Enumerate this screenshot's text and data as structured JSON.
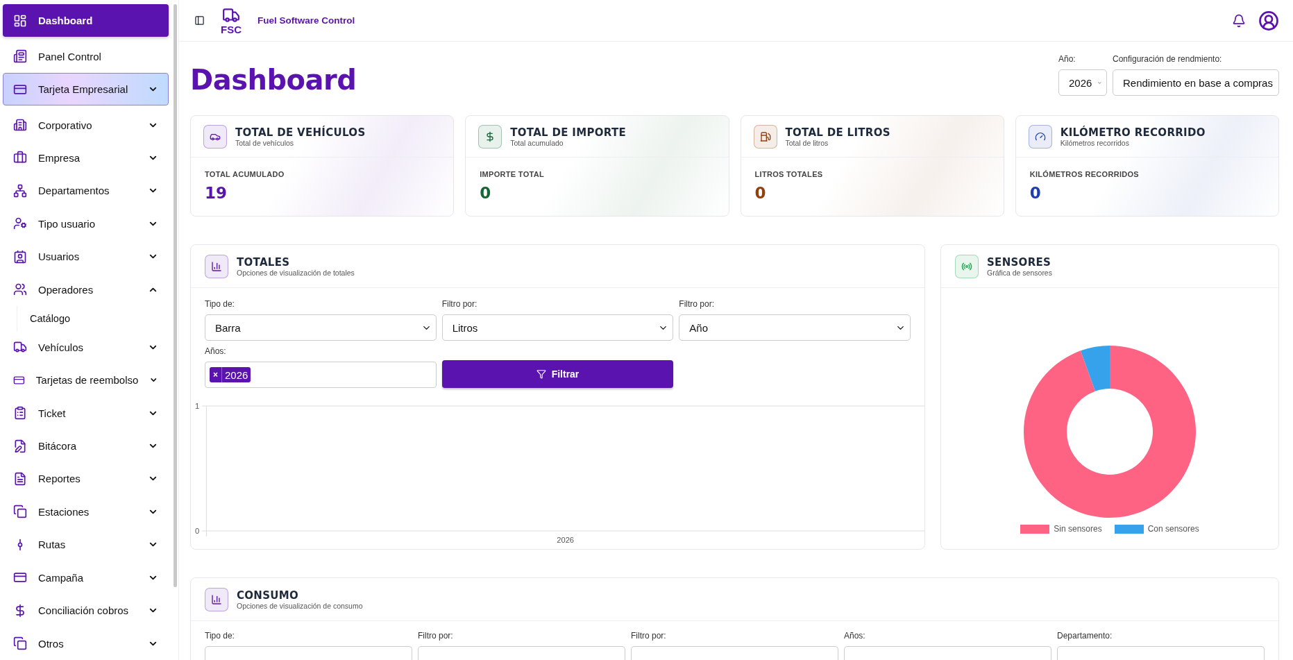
{
  "header": {
    "app_name": "Fuel Software Control",
    "logo_text": "FSC"
  },
  "sidebar": {
    "items": [
      {
        "label": "Dashboard",
        "kind": "link",
        "selected": true,
        "highlighted": false
      },
      {
        "label": "Panel Control",
        "kind": "link",
        "selected": false,
        "highlighted": false
      },
      {
        "label": "Tarjeta Empresarial",
        "kind": "group",
        "selected": false,
        "highlighted": true,
        "expanded": false
      },
      {
        "label": "Corporativo",
        "kind": "group",
        "selected": false,
        "highlighted": false,
        "expanded": false
      },
      {
        "label": "Empresa",
        "kind": "group",
        "selected": false,
        "highlighted": false,
        "expanded": false
      },
      {
        "label": "Departamentos",
        "kind": "group",
        "selected": false,
        "highlighted": false,
        "expanded": false
      },
      {
        "label": "Tipo usuario",
        "kind": "group",
        "selected": false,
        "highlighted": false,
        "expanded": false
      },
      {
        "label": "Usuarios",
        "kind": "group",
        "selected": false,
        "highlighted": false,
        "expanded": false
      },
      {
        "label": "Operadores",
        "kind": "group",
        "selected": false,
        "highlighted": false,
        "expanded": true,
        "children": [
          {
            "label": "Catálogo",
            "selected": false
          }
        ]
      },
      {
        "label": "Vehículos",
        "kind": "group",
        "selected": false,
        "highlighted": false,
        "expanded": false
      },
      {
        "label": "Tarjetas de reembolso",
        "kind": "group",
        "selected": false,
        "highlighted": false,
        "expanded": false
      },
      {
        "label": "Ticket",
        "kind": "group",
        "selected": false,
        "highlighted": false,
        "expanded": false
      },
      {
        "label": "Bitácora",
        "kind": "group",
        "selected": false,
        "highlighted": false,
        "expanded": false
      },
      {
        "label": "Reportes",
        "kind": "group",
        "selected": false,
        "highlighted": false,
        "expanded": false
      },
      {
        "label": "Estaciones",
        "kind": "group",
        "selected": false,
        "highlighted": false,
        "expanded": false
      },
      {
        "label": "Rutas",
        "kind": "group",
        "selected": false,
        "highlighted": false,
        "expanded": false
      },
      {
        "label": "Campaña",
        "kind": "group",
        "selected": false,
        "highlighted": false,
        "expanded": false
      },
      {
        "label": "Conciliación cobros",
        "kind": "group",
        "selected": false,
        "highlighted": false,
        "expanded": false
      },
      {
        "label": "Otros",
        "kind": "group",
        "selected": false,
        "highlighted": false,
        "expanded": false
      }
    ]
  },
  "page": {
    "title": "Dashboard",
    "filters": [
      {
        "label": "Año:",
        "value": "2026"
      },
      {
        "label": "Configuración de rendmiento:",
        "value": "Rendimiento en base a compras"
      }
    ]
  },
  "stat_cards": [
    {
      "title": "TOTAL DE VEHÍCULOS",
      "subtitle": "Total de vehículos",
      "label": "TOTAL ACUMULADO",
      "value": "19",
      "color": "#5b13b0"
    },
    {
      "title": "TOTAL DE IMPORTE",
      "subtitle": "Total acumulado",
      "label": "IMPORTE TOTAL",
      "value": "0",
      "color": "#166534"
    },
    {
      "title": "TOTAL DE LITROS",
      "subtitle": "Total de litros",
      "label": "LITROS TOTALES",
      "value": "0",
      "color": "#92400e"
    },
    {
      "title": "KILÓMETRO RECORRIDO",
      "subtitle": "Kilómetros recorridos",
      "label": "KILÓMETROS RECORRIDOS",
      "value": "0",
      "color": "#1e40af"
    }
  ],
  "totales": {
    "title": "TOTALES",
    "subtitle": "Opciones de visualización de totales",
    "selects": [
      {
        "label": "Tipo de:",
        "value": "Barra"
      },
      {
        "label": "Filtro por:",
        "value": "Litros"
      },
      {
        "label": "Filtro por:",
        "value": "Año"
      }
    ],
    "years_label": "Años:",
    "year_tags": [
      "2026"
    ],
    "tag_remove": "×",
    "filter_button": "Filtrar",
    "chart_data": {
      "type": "bar",
      "categories": [
        "2026"
      ],
      "values": [
        0
      ],
      "ylim": [
        0,
        1
      ],
      "yticks": [
        0,
        1
      ]
    }
  },
  "sensores": {
    "title": "SENSORES",
    "subtitle": "Gráfica de sensores",
    "legend": [
      {
        "label": "Sin sensores",
        "color": "#ff6384"
      },
      {
        "label": "Con sensores",
        "color": "#36a2eb"
      }
    ]
  },
  "consumo": {
    "title": "CONSUMO",
    "subtitle": "Opciones de visualización de consumo",
    "field_labels": [
      "Tipo de:",
      "Filtro por:",
      "Filtro por:",
      "Años:",
      "Departamento:"
    ]
  }
}
